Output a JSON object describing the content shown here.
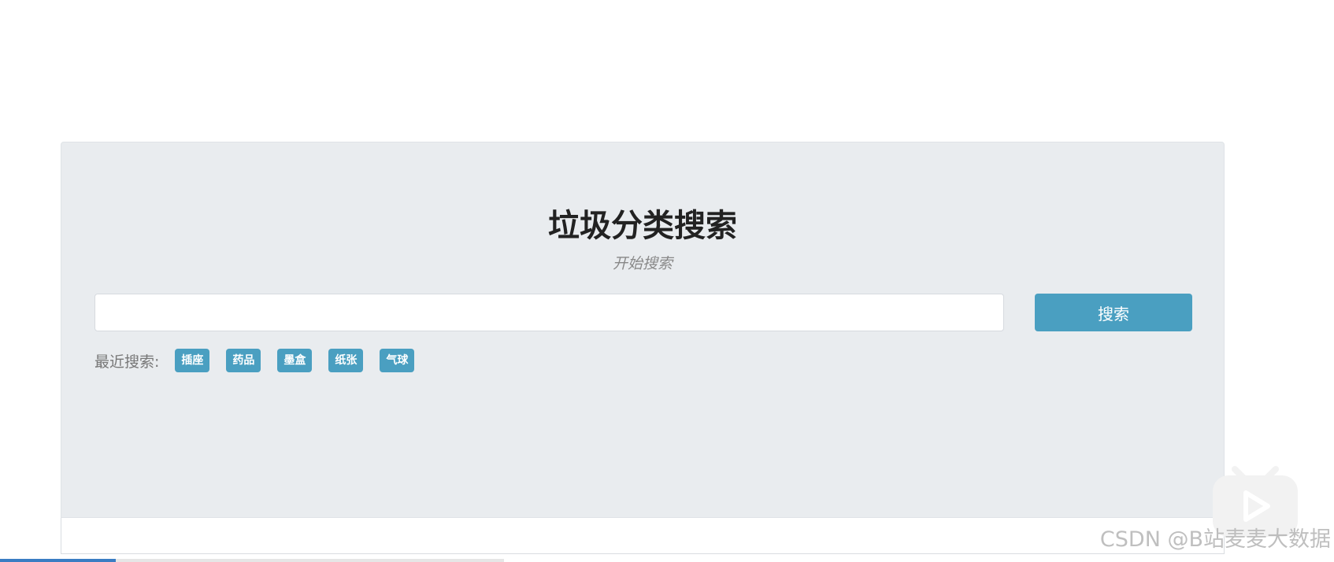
{
  "page": {
    "title": "垃圾分类搜索",
    "subtitle": "开始搜索"
  },
  "search": {
    "value": "",
    "placeholder": "",
    "button_label": "搜索"
  },
  "recent": {
    "label": "最近搜索:",
    "tags": [
      "插座",
      "药品",
      "墨盒",
      "纸张",
      "气球"
    ]
  },
  "video": {
    "progress_percent": 23,
    "watermark": "CSDN @B站麦麦大数据"
  },
  "colors": {
    "accent": "#4a9fc1",
    "panel_bg": "#e9ecef",
    "progress": "#3a7dc3"
  },
  "icons": {
    "play_widget": "play-icon"
  }
}
